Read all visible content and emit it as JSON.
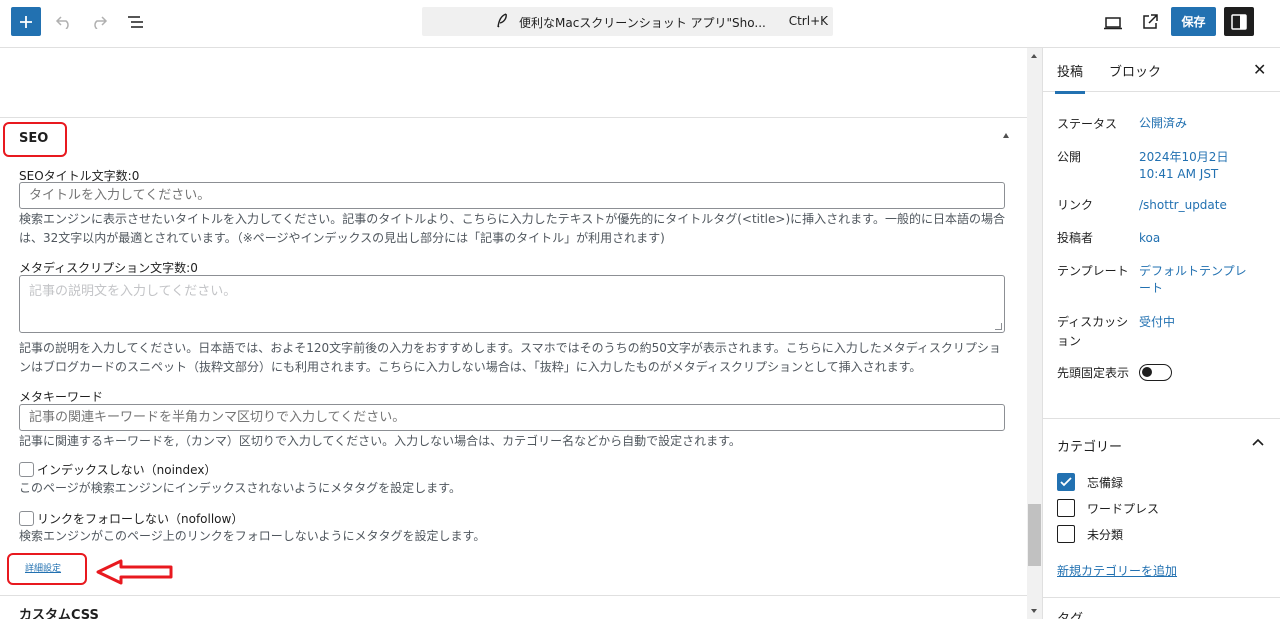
{
  "toolbar": {
    "doc_title": "便利なMacスクリーンショット アプリ\"Sho...",
    "shortcut": "Ctrl+K",
    "save_label": "保存"
  },
  "seo": {
    "section_title": "SEO",
    "title_label": "SEOタイトル文字数:0",
    "title_placeholder": "タイトルを入力してください。",
    "title_help": "検索エンジンに表示させたいタイトルを入力してください。記事のタイトルより、こちらに入力したテキストが優先的にタイトルタグ(<title>)に挿入されます。一般的に日本語の場合は、32文字以内が最適とされています。（※ページやインデックスの見出し部分には「記事のタイトル」が利用されます)",
    "desc_label": "メタディスクリプション文字数:0",
    "desc_placeholder": "記事の説明文を入力してください。",
    "desc_help": "記事の説明を入力してください。日本語では、およそ120文字前後の入力をおすすめします。スマホではそのうちの約50文字が表示されます。こちらに入力したメタディスクリプションはブログカードのスニペット（抜粋文部分）にも利用されます。こちらに入力しない場合は、「抜粋」に入力したものがメタディスクリプションとして挿入されます。",
    "keyword_label": "メタキーワード",
    "keyword_placeholder": "記事の関連キーワードを半角カンマ区切りで入力してください。",
    "keyword_help": "記事に関連するキーワードを,（カンマ）区切りで入力してください。入力しない場合は、カテゴリー名などから自動で設定されます。",
    "noindex_label": "インデックスしない（noindex）",
    "noindex_help": "このページが検索エンジンにインデックスされないようにメタタグを設定します。",
    "nofollow_label": "リンクをフォローしない（nofollow）",
    "nofollow_help": "検索エンジンがこのページ上のリンクをフォローしないようにメタタグを設定します。",
    "advanced_link": "詳細設定",
    "next_section": "カスタムCSS"
  },
  "sidebar": {
    "tab_post": "投稿",
    "tab_block": "ブロック",
    "rows": [
      {
        "label": "ステータス",
        "value": "公開済み"
      },
      {
        "label": "公開",
        "value": "2024年10月2日 10:41 AM JST"
      },
      {
        "label": "リンク",
        "value": "/shottr_update"
      },
      {
        "label": "投稿者",
        "value": "koa"
      },
      {
        "label": "テンプレート",
        "value": "デフォルトテンプレート"
      },
      {
        "label": "ディスカッション",
        "value": "受付中"
      },
      {
        "label": "先頭固定表示",
        "value": ""
      }
    ],
    "category_title": "カテゴリー",
    "categories": [
      {
        "name": "忘備録",
        "checked": true
      },
      {
        "name": "ワードプレス",
        "checked": false
      },
      {
        "name": "未分類",
        "checked": false
      }
    ],
    "new_category": "新規カテゴリーを追加",
    "tag_title": "タグ"
  },
  "colors": {
    "accent": "#2271b1",
    "highlight": "#e8191f"
  }
}
